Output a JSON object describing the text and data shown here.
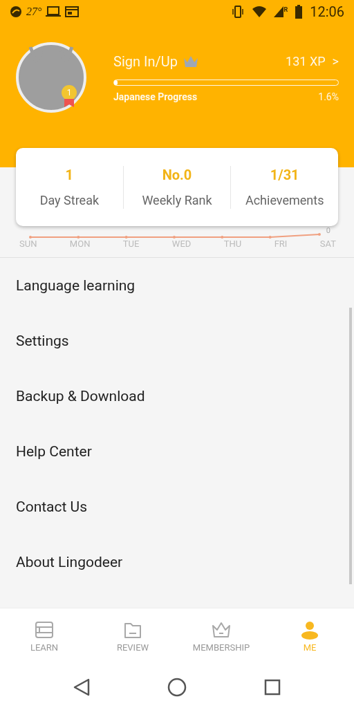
{
  "status_bar": {
    "temperature": "27°",
    "roaming": "R",
    "time": "12:06"
  },
  "profile": {
    "name": "Sign In/Up",
    "badge": "1",
    "xp": "131 XP",
    "chevron": ">",
    "progress_label": "Japanese Progress",
    "progress_value": "1.6%",
    "level": 0.016
  },
  "stats": [
    {
      "value": "1",
      "label": "Day Streak"
    },
    {
      "value": "No.0",
      "label": "Weekly Rank"
    },
    {
      "value": "1/31",
      "label": "Achievements"
    }
  ],
  "week_chart": {
    "end_label": "0",
    "days": [
      "SUN",
      "MON",
      "TUE",
      "WED",
      "THU",
      "FRI",
      "SAT"
    ]
  },
  "menu": [
    "Language learning",
    "Settings",
    "Backup & Download",
    "Help Center",
    "Contact Us",
    "About Lingodeer"
  ],
  "tabs": [
    {
      "label": "LEARN",
      "kind": "learn",
      "selected": false
    },
    {
      "label": "REVIEW",
      "kind": "review",
      "selected": false
    },
    {
      "label": "MEMBERSHIP",
      "kind": "membership",
      "selected": false
    },
    {
      "label": "ME",
      "kind": "me",
      "selected": true
    }
  ]
}
